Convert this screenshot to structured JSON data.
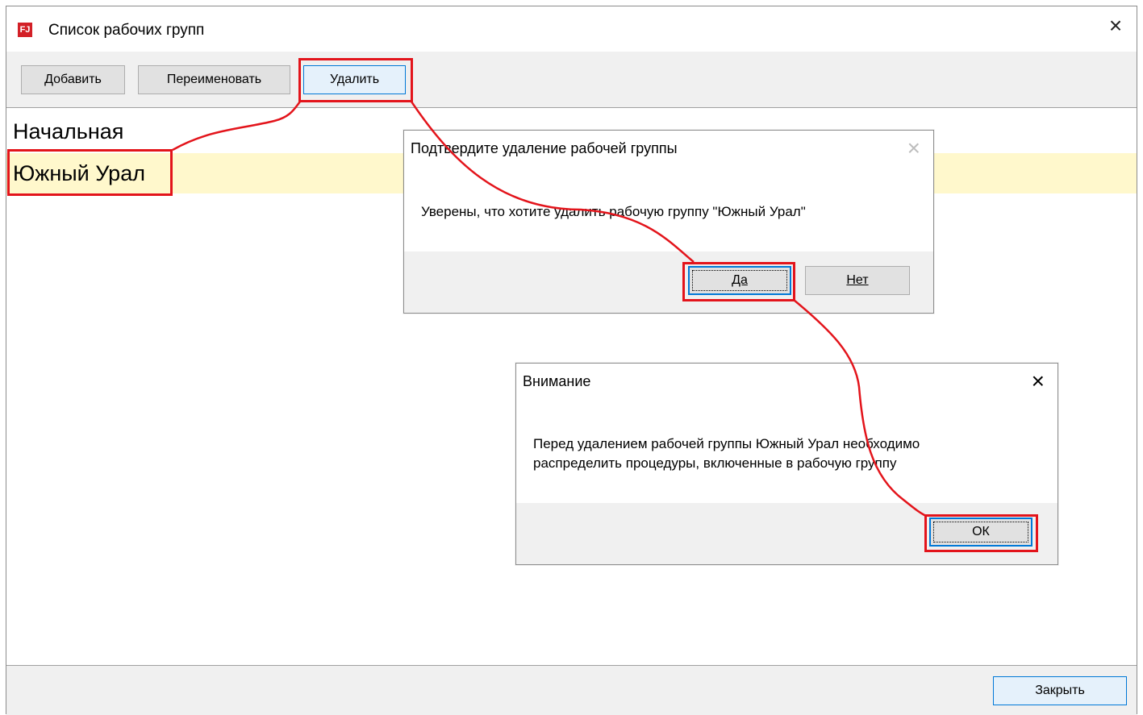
{
  "window": {
    "title": "Список рабочих групп",
    "app_icon_text": "FJ"
  },
  "toolbar": {
    "add_label": "Добавить",
    "rename_label": "Переименовать",
    "delete_label": "Удалить"
  },
  "list": {
    "items": [
      "Начальная",
      "Южный Урал"
    ],
    "selected_index": 1
  },
  "footer": {
    "close_label": "Закрыть"
  },
  "confirm_dialog": {
    "title": "Подтвердите удаление рабочей группы",
    "message": "Уверены, что хотите удалить рабочую группу \"Южный Урал\"",
    "yes_label": "Да",
    "no_label": "Нет"
  },
  "warning_dialog": {
    "title": "Внимание",
    "message_line1": "Перед удалением рабочей группы Южный Урал необходимо",
    "message_line2": "распределить процедуры, включенные в рабочую группу",
    "ok_label": "ОК"
  },
  "colors": {
    "annotation": "#e3141b",
    "selection": "#fff8cc",
    "accent": "#0078d7",
    "app_icon": "#d32027"
  }
}
